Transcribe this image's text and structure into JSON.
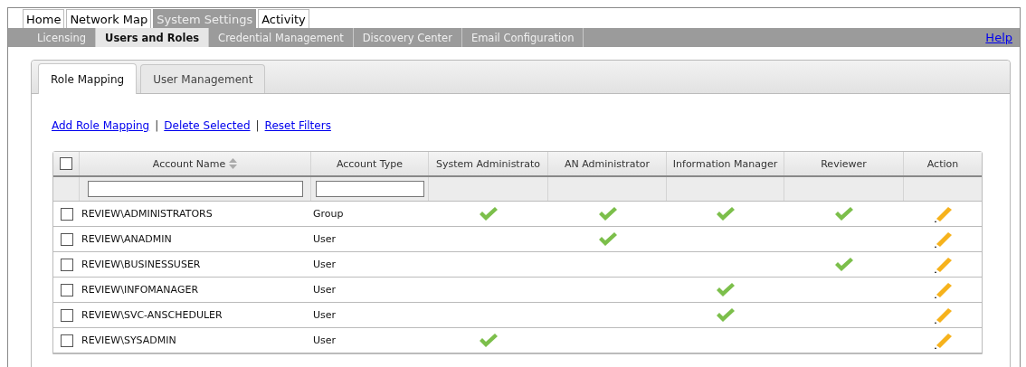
{
  "top_tabs": [
    {
      "label": "Home",
      "selected": false
    },
    {
      "label": "Network Map",
      "selected": false
    },
    {
      "label": "System Settings",
      "selected": true
    },
    {
      "label": "Activity",
      "selected": false
    }
  ],
  "sub_tabs": [
    {
      "label": "Licensing",
      "selected": false
    },
    {
      "label": "Users and Roles",
      "selected": true
    },
    {
      "label": "Credential Management",
      "selected": false
    },
    {
      "label": "Discovery Center",
      "selected": false
    },
    {
      "label": "Email Configuration",
      "selected": false
    }
  ],
  "help_link": "Help",
  "panel_tabs": [
    {
      "label": "Role Mapping",
      "selected": true
    },
    {
      "label": "User Management",
      "selected": false
    }
  ],
  "actions": [
    "Add Role Mapping",
    "Delete Selected",
    "Reset Filters"
  ],
  "separator": "|",
  "table": {
    "select_all_checked": false,
    "columns": [
      "Account Name",
      "Account Type",
      "System Administrato",
      "AN Administrator",
      "Information Manager",
      "Reviewer",
      "Action"
    ],
    "rows": [
      {
        "checked": false,
        "account_name": "REVIEW\\ADMINISTRATORS",
        "account_type": "Group",
        "roles": [
          true,
          true,
          true,
          true
        ]
      },
      {
        "checked": false,
        "account_name": "REVIEW\\ANADMIN",
        "account_type": "User",
        "roles": [
          false,
          true,
          false,
          false
        ]
      },
      {
        "checked": false,
        "account_name": "REVIEW\\BUSINESSUSER",
        "account_type": "User",
        "roles": [
          false,
          false,
          false,
          true
        ]
      },
      {
        "checked": false,
        "account_name": "REVIEW\\INFOMANAGER",
        "account_type": "User",
        "roles": [
          false,
          false,
          true,
          false
        ]
      },
      {
        "checked": false,
        "account_name": "REVIEW\\SVC-ANSCHEDULER",
        "account_type": "User",
        "roles": [
          false,
          false,
          true,
          false
        ]
      },
      {
        "checked": false,
        "account_name": "REVIEW\\SYSADMIN",
        "account_type": "User",
        "roles": [
          true,
          false,
          false,
          false
        ]
      }
    ]
  }
}
